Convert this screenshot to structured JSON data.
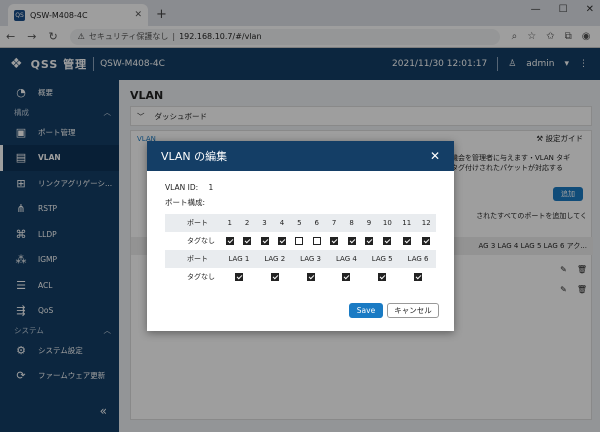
{
  "browser": {
    "tab_title": "QSW-M408-4C",
    "tab_favicon": "QS",
    "security_label": "セキュリティ保護なし",
    "url": "192.168.10.7/#/vlan",
    "warning_icon": "warning-icon"
  },
  "header": {
    "brand": "QSS 管理",
    "model": "QSW-M408-4C",
    "datetime": "2021/11/30  12:01:17",
    "user": "admin"
  },
  "sidebar": {
    "items_top": [
      {
        "label": "概要",
        "icon": "gauge-icon"
      }
    ],
    "group1": "構成",
    "items_config": [
      {
        "label": "ポート管理",
        "icon": "port-icon"
      },
      {
        "label": "VLAN",
        "icon": "vlan-icon",
        "active": true
      },
      {
        "label": "リンクアグリゲーシ...",
        "icon": "link-aggregation-icon"
      },
      {
        "label": "RSTP",
        "icon": "rstp-icon"
      },
      {
        "label": "LLDP",
        "icon": "lldp-icon"
      },
      {
        "label": "IGMP",
        "icon": "igmp-icon"
      },
      {
        "label": "ACL",
        "icon": "acl-icon"
      },
      {
        "label": "QoS",
        "icon": "qos-icon"
      }
    ],
    "group2": "システム",
    "items_system": [
      {
        "label": "システム設定",
        "icon": "gear-icon"
      },
      {
        "label": "ファームウェア更新",
        "icon": "update-icon"
      }
    ]
  },
  "main": {
    "title": "VLAN",
    "dashboard": "ダッシュボード",
    "tab": "VLAN",
    "setup_guide": "設定ガイド",
    "desc_line": "機会を管理者に与えます・VLAN タギ",
    "desc_line2": "タグ付けされたパケットが対応する",
    "add_button": "追加",
    "desc_line3": "されたすべてのポートを追加してく",
    "table_header_partial": "AG 3  LAG 4  LAG 5  LAG 6     アク..."
  },
  "modal": {
    "title": "VLAN の編集",
    "vlan_id_label": "VLAN ID:",
    "vlan_id_value": "1",
    "port_config_label": "ポート構成:",
    "port_row_label": "ポート",
    "untagged_label": "タグなし",
    "ports": [
      "1",
      "2",
      "3",
      "4",
      "5",
      "6",
      "7",
      "8",
      "9",
      "10",
      "11",
      "12"
    ],
    "port_untagged": [
      true,
      true,
      true,
      true,
      false,
      false,
      true,
      true,
      true,
      true,
      true,
      true
    ],
    "lags": [
      "LAG 1",
      "LAG 2",
      "LAG 3",
      "LAG 4",
      "LAG 5",
      "LAG 6"
    ],
    "lag_untagged": [
      true,
      true,
      true,
      true,
      true,
      true
    ],
    "save": "Save",
    "cancel": "キャンセル"
  }
}
